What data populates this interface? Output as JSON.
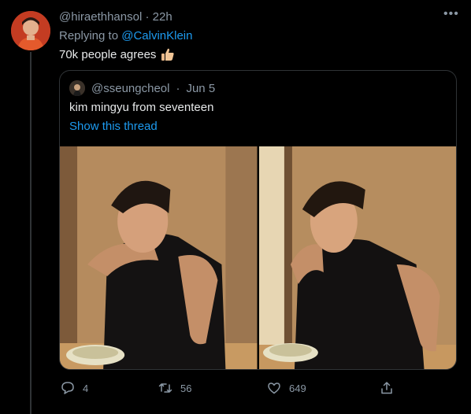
{
  "tweet": {
    "handle": "@hiraethhansol",
    "time": "22h",
    "separator": "·",
    "replying_to_prefix": "Replying to",
    "replying_to_handle": "@CalvinKlein",
    "text": "70k people agrees",
    "emoji_icon": "thumbs-up-icon"
  },
  "quote": {
    "handle": "@sseungcheol",
    "separator": "·",
    "date": "Jun 5",
    "text": "kim mingyu from seventeen",
    "show_thread": "Show this thread"
  },
  "actions": {
    "reply_count": "4",
    "retweet_count": "56",
    "like_count": "649"
  },
  "icons": [
    "more-icon",
    "reply-icon",
    "retweet-icon",
    "like-icon",
    "share-icon"
  ],
  "colors": {
    "background": "#000000",
    "link": "#1d9bf0",
    "muted": "#8b98a5",
    "text": "#e7e9ea",
    "border": "#2f3336"
  }
}
